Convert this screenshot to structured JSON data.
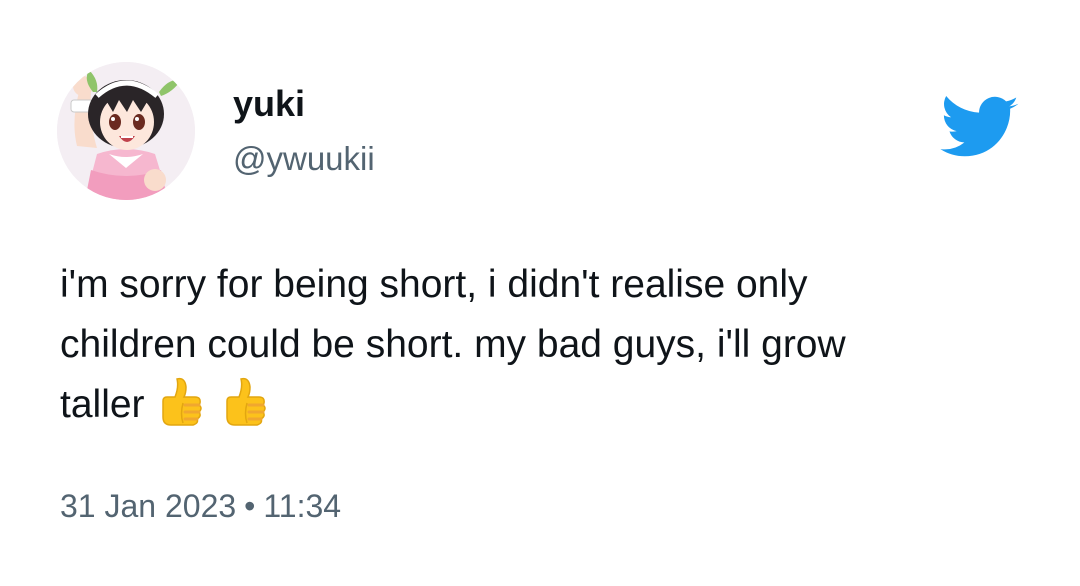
{
  "tweet": {
    "author": {
      "display_name": "yuki",
      "handle": "@ywuukii",
      "avatar": "anime-girl-avatar"
    },
    "text_lines": [
      "i'm sorry for being short, i didn't realise only",
      "children could be short. my bad guys, i'll grow",
      "taller"
    ],
    "emojis": [
      "thumbs-up-emoji",
      "thumbs-up-emoji"
    ],
    "date": "31 Jan 2023",
    "separator": "•",
    "time": "11:34"
  },
  "branding": {
    "logo": "twitter-bird-icon",
    "logo_color": "#1d9bf0"
  },
  "colors": {
    "text": "#0f1419",
    "secondary_text": "#536471",
    "background": "#ffffff"
  }
}
